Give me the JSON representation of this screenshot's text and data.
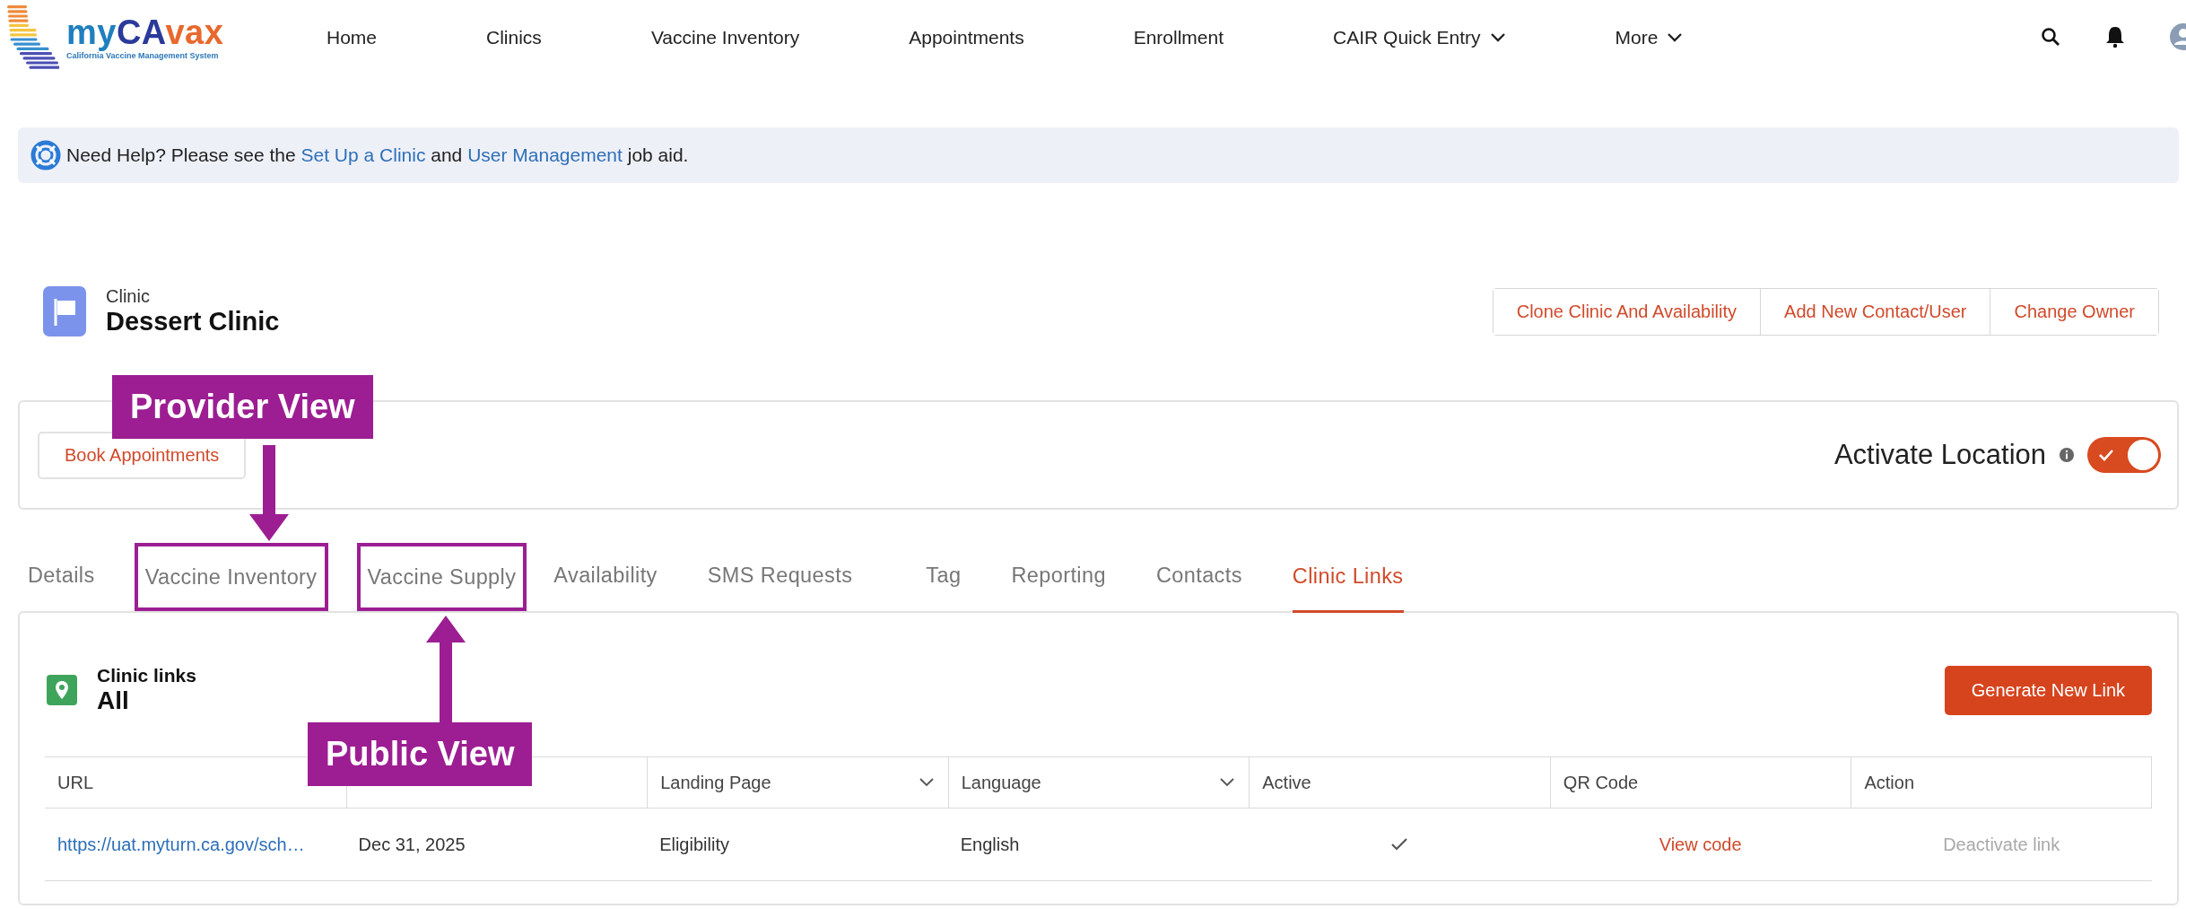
{
  "logo": {
    "name": "myCAvax",
    "tagline": "California Vaccine Management System"
  },
  "nav": [
    {
      "label": "Home",
      "dropdown": false
    },
    {
      "label": "Clinics",
      "dropdown": false
    },
    {
      "label": "Vaccine Inventory",
      "dropdown": false
    },
    {
      "label": "Appointments",
      "dropdown": false
    },
    {
      "label": "Enrollment",
      "dropdown": false
    },
    {
      "label": "CAIR Quick Entry",
      "dropdown": true
    },
    {
      "label": "More",
      "dropdown": true
    }
  ],
  "help": {
    "parts": [
      {
        "kind": "text",
        "text": "Need Help? Please see the "
      },
      {
        "kind": "link",
        "text": "Set Up a Clinic"
      },
      {
        "kind": "text",
        "text": " and "
      },
      {
        "kind": "link",
        "text": "User Management"
      },
      {
        "kind": "text",
        "text": " job aid."
      }
    ]
  },
  "record": {
    "type": "Clinic",
    "name": "Dessert Clinic"
  },
  "actions": [
    "Clone Clinic And Availability",
    "Add New Contact/User",
    "Change Owner"
  ],
  "booking": {
    "button": "Book Appointments",
    "toggle_label": "Activate Location",
    "on": true
  },
  "tabs": [
    {
      "label": "Details",
      "selected": false,
      "outlined": false
    },
    {
      "label": "Vaccine Inventory",
      "selected": false,
      "outlined": true
    },
    {
      "label": "Vaccine Supply",
      "selected": false,
      "outlined": true
    },
    {
      "label": "Availability",
      "selected": false,
      "outlined": false
    },
    {
      "label": "SMS Requests",
      "selected": false,
      "outlined": false
    },
    {
      "label": "Tag",
      "selected": false,
      "outlined": false
    },
    {
      "label": "Reporting",
      "selected": false,
      "outlined": false
    },
    {
      "label": "Contacts",
      "selected": false,
      "outlined": false
    },
    {
      "label": "Clinic Links",
      "selected": true,
      "outlined": false
    }
  ],
  "links_panel": {
    "label": "Clinic links",
    "filter": "All",
    "button": "Generate New Link",
    "columns": [
      {
        "kind": "text",
        "label": "URL",
        "dropdown": false
      },
      {
        "kind": "covered"
      },
      {
        "kind": "text",
        "label": "Landing Page",
        "dropdown": true
      },
      {
        "kind": "text",
        "label": "Language",
        "dropdown": true
      },
      {
        "kind": "text",
        "label": "Active",
        "dropdown": false
      },
      {
        "kind": "text",
        "label": "QR Code",
        "dropdown": false
      },
      {
        "kind": "text",
        "label": "Action",
        "dropdown": false
      }
    ],
    "rows": [
      {
        "url": "https://uat.myturn.ca.gov/sch…",
        "expiration": "Dec 31, 2025",
        "landing_page": "Eligibility",
        "language": "English",
        "active": true,
        "qr": "View code",
        "action": "Deactivate link",
        "action_disabled": true
      }
    ]
  },
  "annotations": [
    {
      "kind": "callout-down",
      "text": "Provider View"
    },
    {
      "kind": "callout-up",
      "text": "Public View"
    }
  ]
}
